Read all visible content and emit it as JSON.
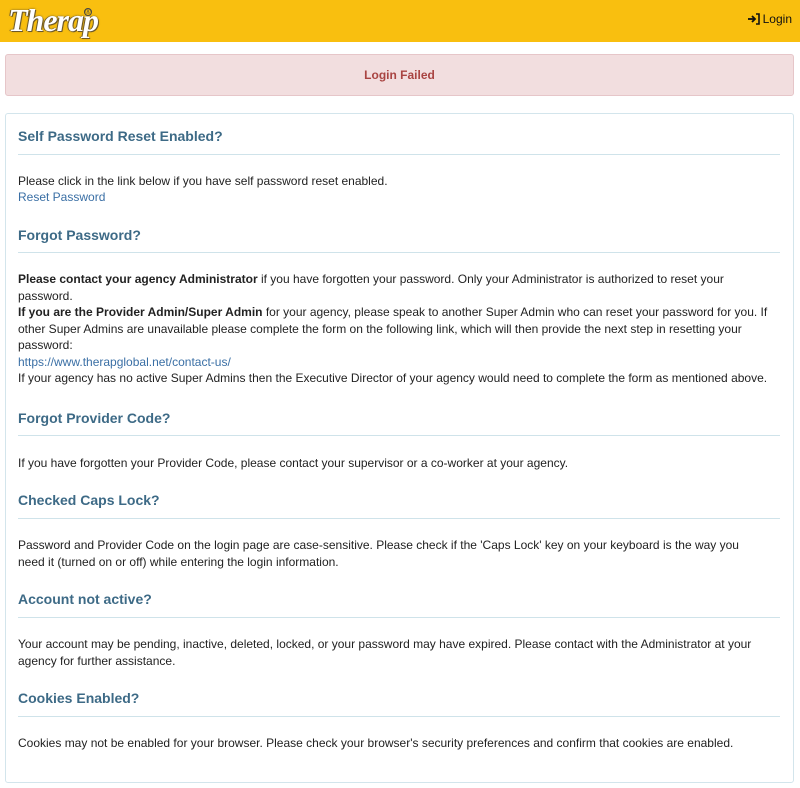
{
  "header": {
    "logo_text": "Therap",
    "logo_mark": "®",
    "login_label": "Login",
    "login_icon": "sign-in-icon",
    "background": "#f9bf0f"
  },
  "alert": {
    "message": "Login Failed",
    "color": "#a94442",
    "background": "#f2dedf"
  },
  "sections": {
    "reset": {
      "title": "Self Password Reset Enabled?",
      "text": "Please click in the link below if you have self password reset enabled.",
      "link": "Reset Password"
    },
    "forgot_password": {
      "title": "Forgot Password?",
      "p1_bold": "Please contact your agency Administrator",
      "p1_rest": " if you have forgotten your password.  Only your Administrator is authorized to reset your password.",
      "p2_bold": "If you are the Provider Admin/Super Admin",
      "p2_rest": " for your agency, please speak to another Super Admin who can reset your password for you. If other Super Admins are unavailable please complete the form on the following link, which will then provide the next step in resetting your password:",
      "link": "https://www.therapglobal.net/contact-us/",
      "p3": "If your agency has no active Super Admins then the Executive Director of your agency would need to complete the form as mentioned above."
    },
    "forgot_code": {
      "title": "Forgot Provider Code?",
      "text": "If you have forgotten your Provider Code, please contact your supervisor or a co-worker at your agency."
    },
    "caps_lock": {
      "title": "Checked Caps Lock?",
      "text": "Password and Provider Code on the login page are case-sensitive. Please check if the 'Caps Lock' key on your keyboard is the way you need it (turned on or off) while entering the login information."
    },
    "not_active": {
      "title": "Account not active?",
      "text": "Your account may be pending, inactive, deleted, locked, or your password may have expired. Please contact with the Administrator at your agency for further assistance."
    },
    "cookies": {
      "title": "Cookies Enabled?",
      "text": "Cookies may not be enabled for your browser. Please check your browser's security preferences and confirm that cookies are enabled."
    }
  },
  "colors": {
    "section_title": "#3d6a86",
    "link": "#3a6fa5",
    "rule": "#cfe3ea"
  }
}
